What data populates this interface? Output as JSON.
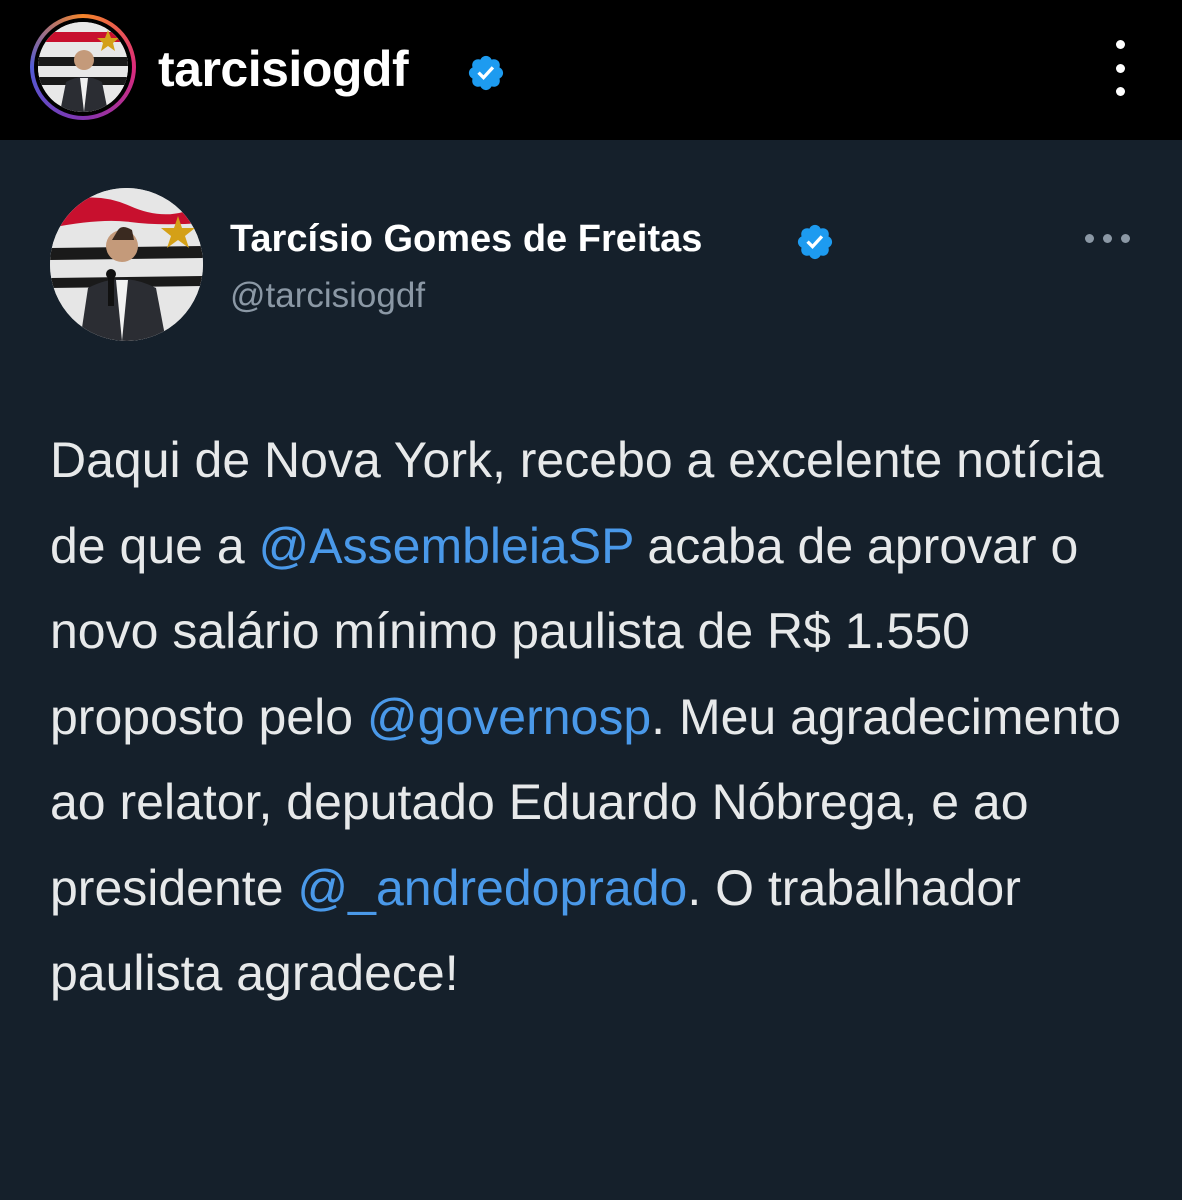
{
  "header": {
    "username": "tarcisiogdf",
    "verified": true,
    "more_icon": "more-vertical-icon"
  },
  "tweet": {
    "display_name": "Tarcísio Gomes de Freitas",
    "handle": "@tarcisiogdf",
    "verified": true,
    "more_icon": "more-horizontal-icon",
    "text": {
      "p1": "Daqui de Nova York, recebo a excelente notícia de que a ",
      "mention1": "@AssembleiaSP",
      "p2": " acaba de aprovar o novo salário mínimo paulista de R$ 1.550 proposto pelo ",
      "mention2": "@governosp",
      "p3": ". Meu agradecimento ao relator, deputado Eduardo Nóbrega, e ao presidente ",
      "mention3": "@_andredoprado",
      "p4": ". O trabalhador paulista agradece!"
    }
  },
  "colors": {
    "header_bg": "#000000",
    "tweet_bg": "#15202b",
    "text": "#e7e9ea",
    "secondary_text": "#8b98a5",
    "mention": "#4a99e9",
    "verified": "#1d9bf0"
  }
}
